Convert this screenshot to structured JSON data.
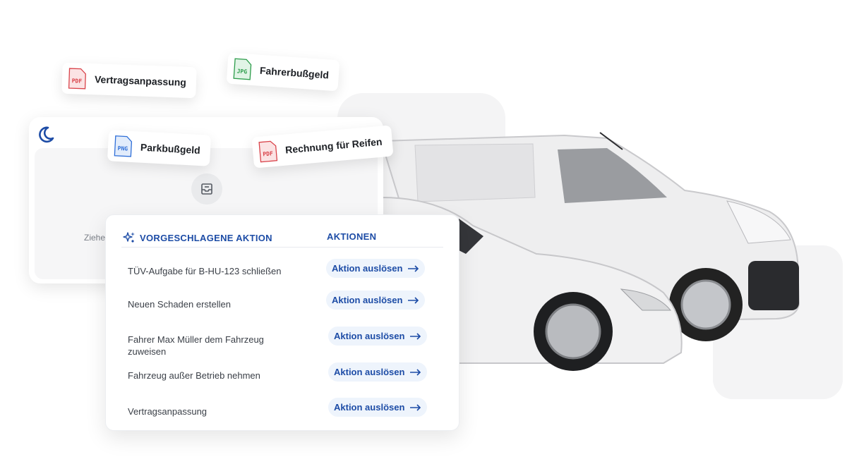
{
  "files": [
    {
      "type": "PDF",
      "name": "Vertragsanpassung",
      "color": "#d9434a"
    },
    {
      "type": "JPG",
      "name": "Fahrerbußgeld",
      "color": "#2c9c4a"
    },
    {
      "type": "PNG",
      "name": "Parkbußgeld",
      "color": "#2f6fd8"
    },
    {
      "type": "PDF",
      "name": "Rechnung für Reifen",
      "color": "#d9434a"
    }
  ],
  "upload": {
    "logo_icon": "moon-logo-icon",
    "tray_icon": "inbox-tray-icon",
    "hint": "Ziehe"
  },
  "table": {
    "col_suggested": "VORGESCHLAGENE AKTION",
    "col_actions": "AKTIONEN",
    "rows": [
      {
        "label": "TÜV-Aufgabe für B-HU-123 schließen",
        "button": "Aktion auslösen"
      },
      {
        "label": "Neuen Schaden erstellen",
        "button": "Aktion auslösen"
      },
      {
        "label": "Fahrer Max Müller dem Fahrzeug zuweisen",
        "button": "Aktion auslösen"
      },
      {
        "label": "Fahrzeug außer Betrieb nehmen",
        "button": "Aktion auslösen"
      },
      {
        "label": "Vertragsanpassung",
        "button": "Aktion auslösen"
      }
    ]
  },
  "colors": {
    "accent": "#1d4ca6",
    "button_bg": "#eef4fc",
    "panel_bg": "#f4f4f5"
  }
}
